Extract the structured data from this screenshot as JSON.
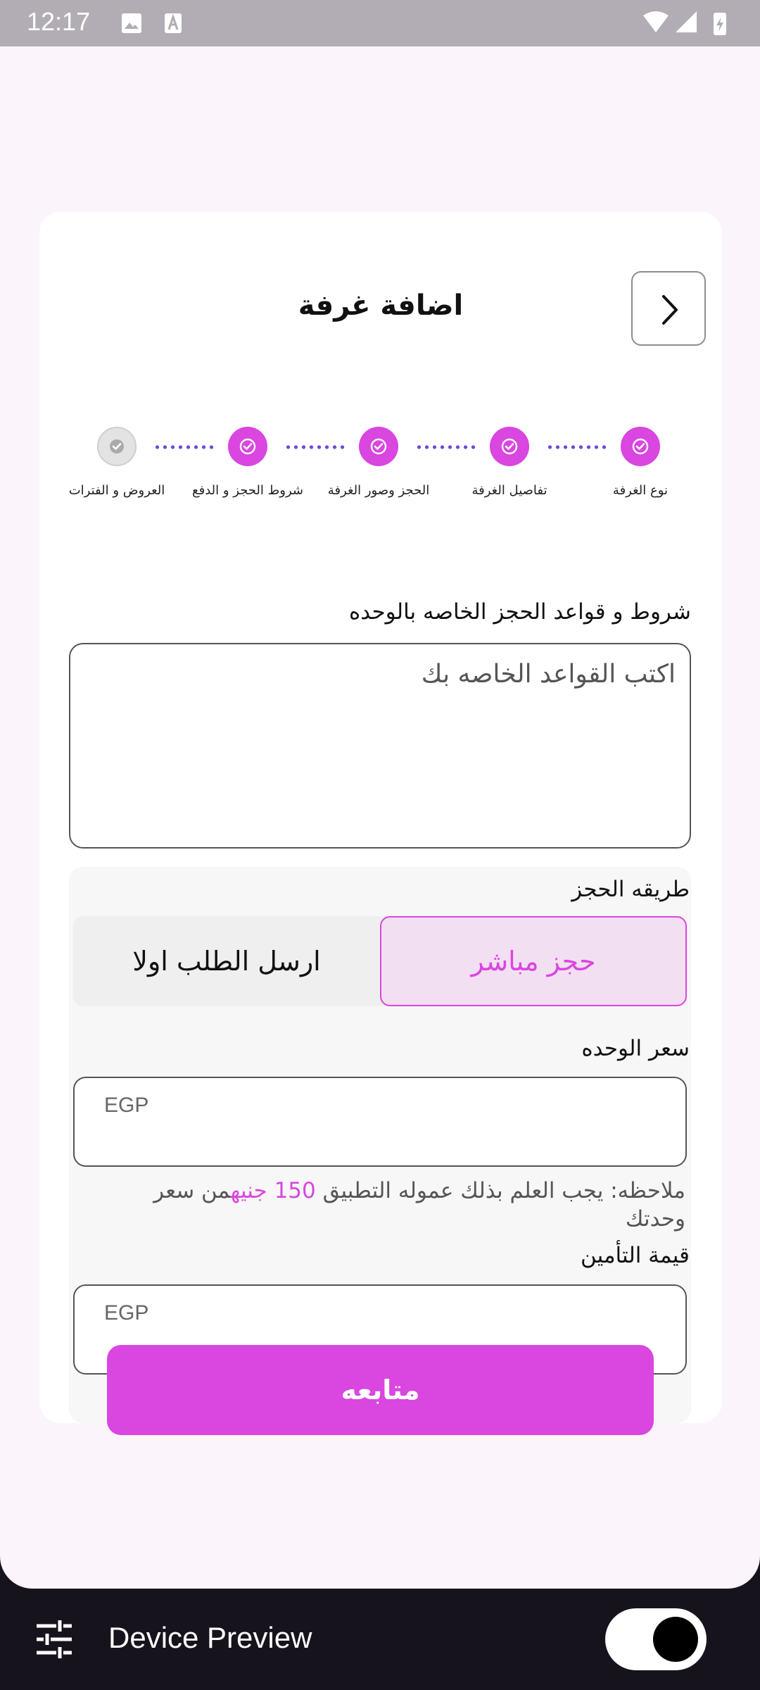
{
  "status": {
    "time": "12:17"
  },
  "header": {
    "title": "اضافة غرفة"
  },
  "steps": [
    {
      "label": "نوع الغرفة",
      "state": "done"
    },
    {
      "label": "تفاصيل الغرفة",
      "state": "done"
    },
    {
      "label": "الحجز وصور الغرفة",
      "state": "done"
    },
    {
      "label": "شروط الحجز و الدفع",
      "state": "done"
    },
    {
      "label": "العروض و الفترات",
      "state": "pending"
    }
  ],
  "rules": {
    "label": "شروط و قواعد الحجز الخاصه بالوحده",
    "placeholder": "اكتب القواعد الخاصه بك"
  },
  "booking": {
    "label": "طريقه الحجز",
    "options": [
      "حجز مباشر",
      "ارسل الطلب اولا"
    ],
    "selected": "حجز مباشر"
  },
  "price": {
    "label": "سعر الوحده",
    "placeholder": "EGP",
    "note_prefix": "ملاحظه: يجب العلم بذلك عموله التطبيق ",
    "note_highlight": "150 جنيه",
    "note_suffix": "من سعر وحدتك"
  },
  "deposit": {
    "label": "قيمة التأمين",
    "placeholder": "EGP"
  },
  "continue_button": "متابعه",
  "device_preview": {
    "label": "Device Preview",
    "enabled": true
  },
  "colors": {
    "accent": "#d946e0",
    "dots": "#6c4bd8",
    "background": "#fcf4fb"
  }
}
